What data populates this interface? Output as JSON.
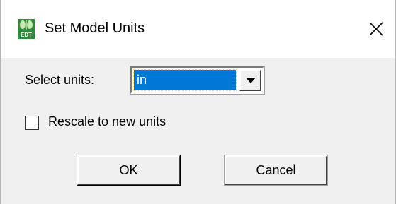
{
  "window": {
    "title": "Set Model Units",
    "app_icon": "edt-app-icon",
    "close_icon": "close-icon"
  },
  "form": {
    "units_label": "Select units:",
    "units_value": "in",
    "rescale_label": "Rescale to new units",
    "rescale_checked": false
  },
  "buttons": {
    "ok_label": "OK",
    "cancel_label": "Cancel"
  },
  "colors": {
    "selection": "#0078d7",
    "face": "#f0f0f0",
    "titlebar": "#ffffff"
  }
}
